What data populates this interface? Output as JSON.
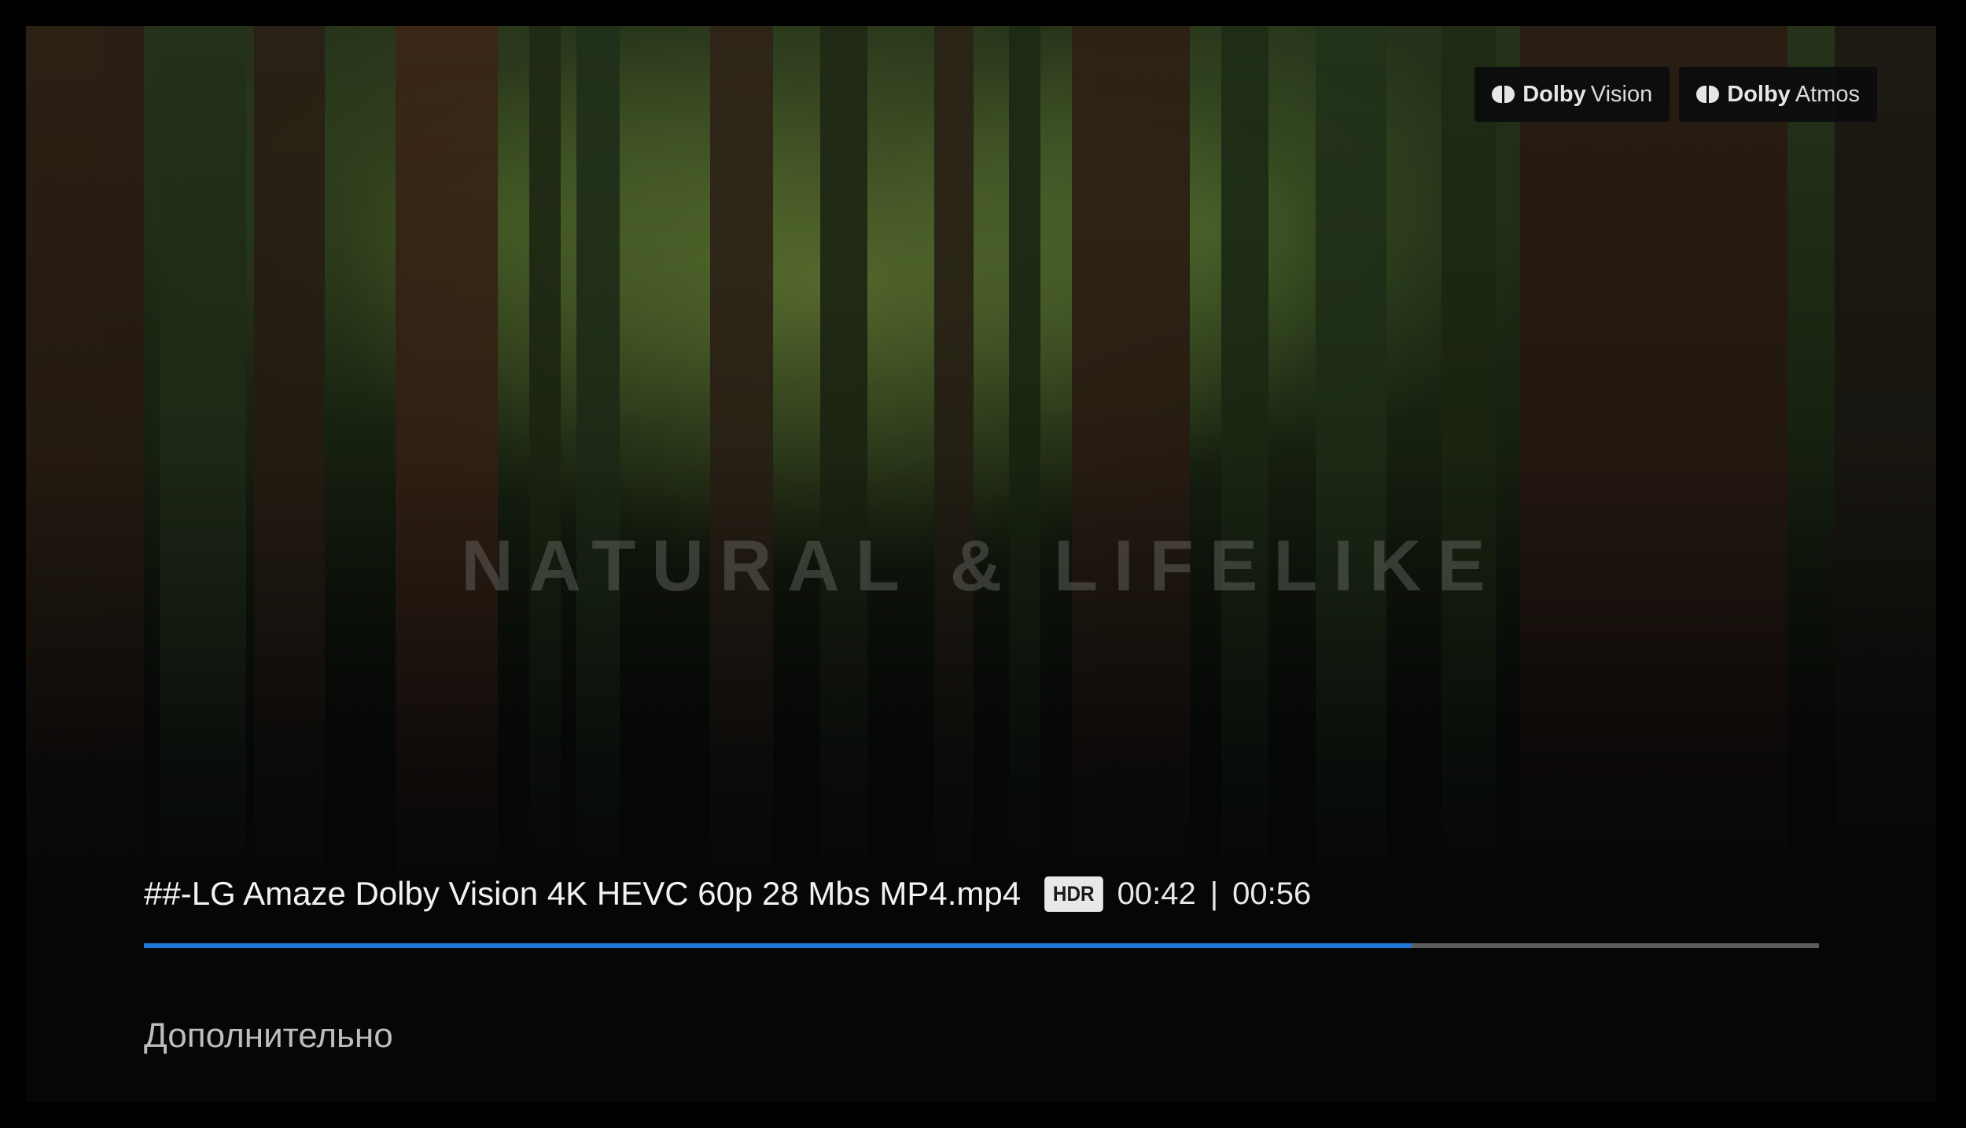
{
  "video": {
    "watermark": "NATURAL & LIFELIKE"
  },
  "badges": [
    {
      "brand": "Dolby",
      "sub": "Vision"
    },
    {
      "brand": "Dolby",
      "sub": "Atmos"
    }
  ],
  "player": {
    "file_title": "##-LG Amaze Dolby Vision 4K HEVC 60p 28 Mbs MP4.mp4",
    "hdr_label": "HDR",
    "current_time": "00:42",
    "separator": "|",
    "total_time": "00:56",
    "progress": 0.757,
    "progress_color": "#1f78d8",
    "more_label": "Дополнительно"
  }
}
